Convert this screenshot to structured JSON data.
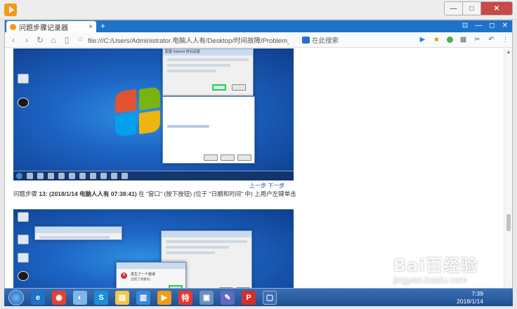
{
  "window": {
    "minimize": "—",
    "maximize": "□",
    "close": "✕"
  },
  "browser": {
    "tab_label": "问题步骤记录器",
    "tab_close": "×",
    "new_tab": "+",
    "tabbar_icons": [
      "⊡",
      "—",
      "◻",
      "✕"
    ],
    "address": "file:///C:/Users/Administrator.电脑人人有/Desktop/时间故障/Problem_20180114_1539.mht",
    "search_placeholder": "在此搜索",
    "icons": [
      "back-icon",
      "forward-icon",
      "refresh-icon",
      "home-icon",
      "page-icon"
    ]
  },
  "page": {
    "nav_links": "上一步 下一步",
    "caption_prefix": "问题步骤 ",
    "caption_bold": "13: (2018/1/14 电脑人人有 07:38:41)",
    "caption_rest": " 在 \"窗口\" (按下按钮) (位于 \"日期和时间\" 中) 上用户左键单击",
    "shot1_dialog_title": "配置 Internet 时间设置",
    "shot2_error_title": "发生了一个错误",
    "shot2_error_sub": "出错了请重试。"
  },
  "taskbar": {
    "time": "7:39",
    "date": "2018/1/14"
  },
  "watermark": {
    "main": "Bai百经验",
    "sub": "jingyan.baidu.com"
  }
}
